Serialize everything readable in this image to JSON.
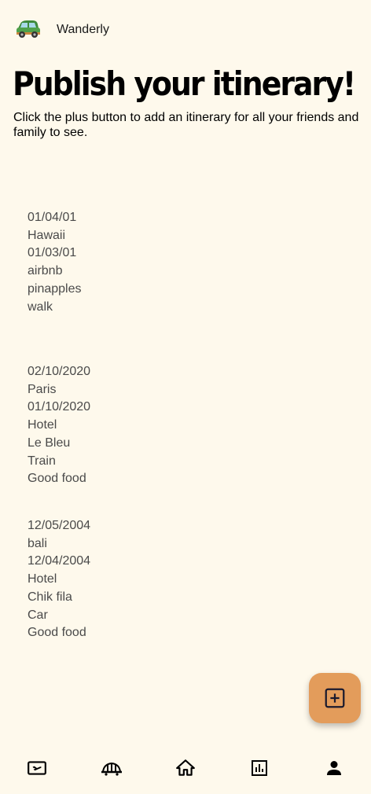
{
  "app": {
    "name": "Wanderly",
    "logo": "green-car-icon"
  },
  "header": {
    "title": "Publish your itinerary!",
    "subtitle": "Click the plus button to add an itinerary for all your friends and family to see."
  },
  "itineraries": [
    {
      "end_date": "01/04/01",
      "destination": "Hawaii",
      "start_date": "01/03/01",
      "accommodation": "airbnb",
      "place": "pinapples",
      "transport": "walk"
    },
    {
      "end_date": "02/10/2020",
      "destination": "Paris",
      "start_date": "01/10/2020",
      "accommodation": "Hotel",
      "place": "Le Bleu",
      "transport": "Train",
      "note": "Good food"
    },
    {
      "end_date": "12/05/2004",
      "destination": "bali",
      "start_date": "12/04/2004",
      "accommodation": "Hotel",
      "place": "Chik fila",
      "transport": "Car",
      "note": "Good food"
    }
  ],
  "fab": {
    "icon": "add-box-icon",
    "color": "#e39c5b"
  },
  "bottom_nav": [
    {
      "icon": "flight-ticket-icon"
    },
    {
      "icon": "cable-car-icon"
    },
    {
      "icon": "home-icon"
    },
    {
      "icon": "bar-chart-icon"
    },
    {
      "icon": "person-icon"
    }
  ],
  "colors": {
    "background": "#fef9ec",
    "accent": "#e39c5b",
    "text_muted": "#4a4a4a"
  }
}
